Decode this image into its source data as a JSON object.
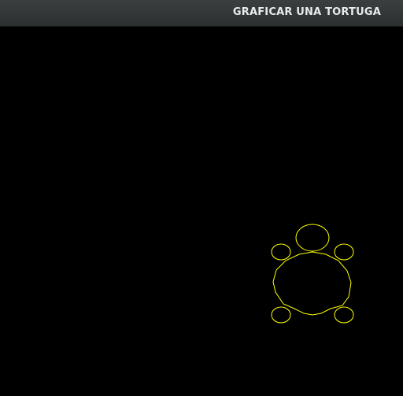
{
  "window": {
    "title": "GRAFICAR UNA TORTUGA"
  },
  "drawing": {
    "stroke_color": "#ffff00",
    "background_color": "#000000",
    "shapes": [
      "head",
      "shell",
      "leg-front-left",
      "leg-front-right",
      "leg-back-left",
      "leg-back-right"
    ]
  }
}
